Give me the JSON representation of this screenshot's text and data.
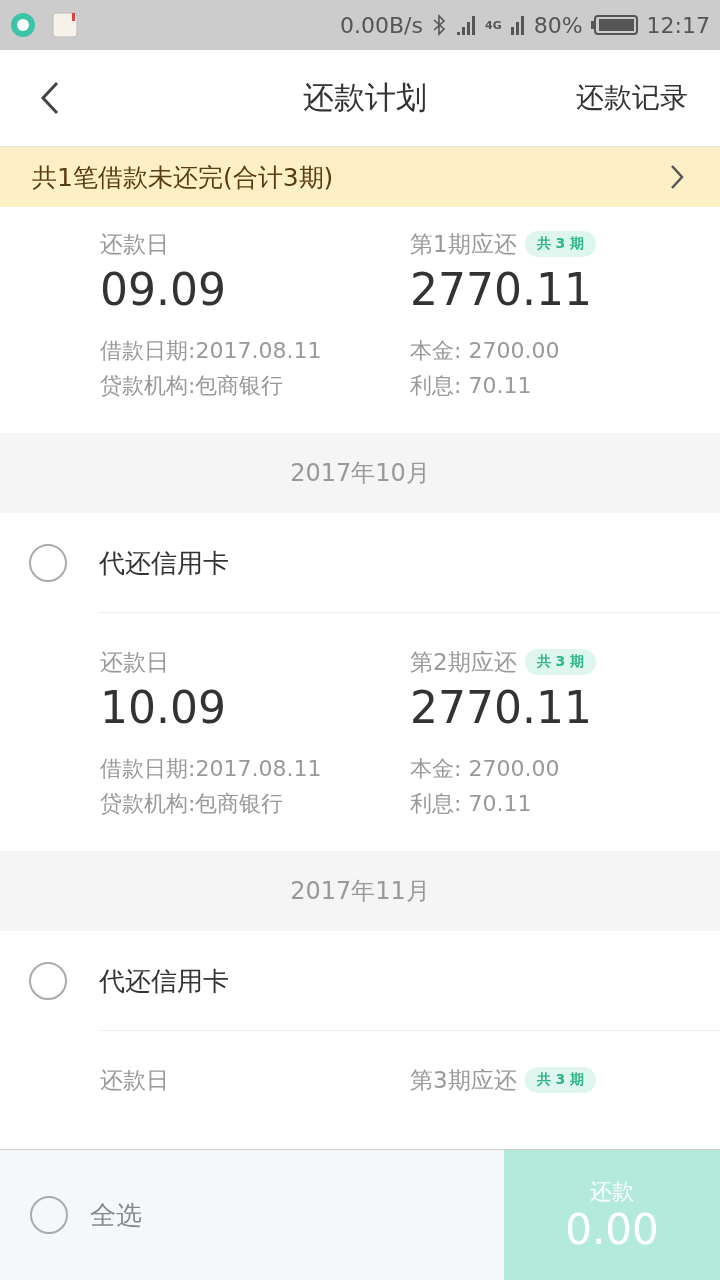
{
  "status_bar": {
    "speed": "0.00B/s",
    "network": "4G",
    "battery": "80%",
    "time": "12:17"
  },
  "header": {
    "title": "还款计划",
    "action": "还款记录"
  },
  "notice": {
    "text": "共1笔借款未还完(合计3期)"
  },
  "loans": [
    {
      "repay_label": "还款日",
      "day": "09.09",
      "due_label": "第1期应还",
      "badge": "共 3 期",
      "amount": "2770.11",
      "loan_date": "借款日期:2017.08.11",
      "lender": "贷款机构:包商银行",
      "principal": "本金: 2700.00",
      "interest": "利息: 70.11"
    },
    {
      "month": "2017年10月",
      "title": "代还信用卡",
      "checked": false,
      "repay_label": "还款日",
      "day": "10.09",
      "due_label": "第2期应还",
      "badge": "共 3 期",
      "amount": "2770.11",
      "loan_date": "借款日期:2017.08.11",
      "lender": "贷款机构:包商银行",
      "principal": "本金: 2700.00",
      "interest": "利息: 70.11"
    },
    {
      "month": "2017年11月",
      "title": "代还信用卡",
      "checked": false,
      "repay_label": "还款日",
      "due_label": "第3期应还",
      "badge": "共 3 期"
    }
  ],
  "footer": {
    "select_all": "全选",
    "select_all_checked": false,
    "pay_label": "还款",
    "pay_amount": "0.00"
  }
}
